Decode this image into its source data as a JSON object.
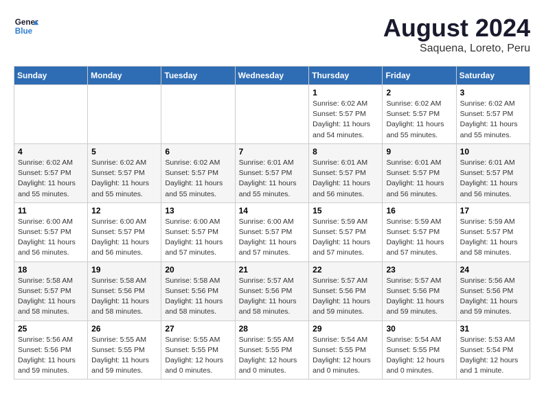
{
  "header": {
    "logo_line1": "General",
    "logo_line2": "Blue",
    "main_title": "August 2024",
    "subtitle": "Saquena, Loreto, Peru"
  },
  "weekdays": [
    "Sunday",
    "Monday",
    "Tuesday",
    "Wednesday",
    "Thursday",
    "Friday",
    "Saturday"
  ],
  "weeks": [
    [
      {
        "day": "",
        "info": ""
      },
      {
        "day": "",
        "info": ""
      },
      {
        "day": "",
        "info": ""
      },
      {
        "day": "",
        "info": ""
      },
      {
        "day": "1",
        "info": "Sunrise: 6:02 AM\nSunset: 5:57 PM\nDaylight: 11 hours and 54 minutes."
      },
      {
        "day": "2",
        "info": "Sunrise: 6:02 AM\nSunset: 5:57 PM\nDaylight: 11 hours and 55 minutes."
      },
      {
        "day": "3",
        "info": "Sunrise: 6:02 AM\nSunset: 5:57 PM\nDaylight: 11 hours and 55 minutes."
      }
    ],
    [
      {
        "day": "4",
        "info": "Sunrise: 6:02 AM\nSunset: 5:57 PM\nDaylight: 11 hours and 55 minutes."
      },
      {
        "day": "5",
        "info": "Sunrise: 6:02 AM\nSunset: 5:57 PM\nDaylight: 11 hours and 55 minutes."
      },
      {
        "day": "6",
        "info": "Sunrise: 6:02 AM\nSunset: 5:57 PM\nDaylight: 11 hours and 55 minutes."
      },
      {
        "day": "7",
        "info": "Sunrise: 6:01 AM\nSunset: 5:57 PM\nDaylight: 11 hours and 55 minutes."
      },
      {
        "day": "8",
        "info": "Sunrise: 6:01 AM\nSunset: 5:57 PM\nDaylight: 11 hours and 56 minutes."
      },
      {
        "day": "9",
        "info": "Sunrise: 6:01 AM\nSunset: 5:57 PM\nDaylight: 11 hours and 56 minutes."
      },
      {
        "day": "10",
        "info": "Sunrise: 6:01 AM\nSunset: 5:57 PM\nDaylight: 11 hours and 56 minutes."
      }
    ],
    [
      {
        "day": "11",
        "info": "Sunrise: 6:00 AM\nSunset: 5:57 PM\nDaylight: 11 hours and 56 minutes."
      },
      {
        "day": "12",
        "info": "Sunrise: 6:00 AM\nSunset: 5:57 PM\nDaylight: 11 hours and 56 minutes."
      },
      {
        "day": "13",
        "info": "Sunrise: 6:00 AM\nSunset: 5:57 PM\nDaylight: 11 hours and 57 minutes."
      },
      {
        "day": "14",
        "info": "Sunrise: 6:00 AM\nSunset: 5:57 PM\nDaylight: 11 hours and 57 minutes."
      },
      {
        "day": "15",
        "info": "Sunrise: 5:59 AM\nSunset: 5:57 PM\nDaylight: 11 hours and 57 minutes."
      },
      {
        "day": "16",
        "info": "Sunrise: 5:59 AM\nSunset: 5:57 PM\nDaylight: 11 hours and 57 minutes."
      },
      {
        "day": "17",
        "info": "Sunrise: 5:59 AM\nSunset: 5:57 PM\nDaylight: 11 hours and 58 minutes."
      }
    ],
    [
      {
        "day": "18",
        "info": "Sunrise: 5:58 AM\nSunset: 5:57 PM\nDaylight: 11 hours and 58 minutes."
      },
      {
        "day": "19",
        "info": "Sunrise: 5:58 AM\nSunset: 5:56 PM\nDaylight: 11 hours and 58 minutes."
      },
      {
        "day": "20",
        "info": "Sunrise: 5:58 AM\nSunset: 5:56 PM\nDaylight: 11 hours and 58 minutes."
      },
      {
        "day": "21",
        "info": "Sunrise: 5:57 AM\nSunset: 5:56 PM\nDaylight: 11 hours and 58 minutes."
      },
      {
        "day": "22",
        "info": "Sunrise: 5:57 AM\nSunset: 5:56 PM\nDaylight: 11 hours and 59 minutes."
      },
      {
        "day": "23",
        "info": "Sunrise: 5:57 AM\nSunset: 5:56 PM\nDaylight: 11 hours and 59 minutes."
      },
      {
        "day": "24",
        "info": "Sunrise: 5:56 AM\nSunset: 5:56 PM\nDaylight: 11 hours and 59 minutes."
      }
    ],
    [
      {
        "day": "25",
        "info": "Sunrise: 5:56 AM\nSunset: 5:56 PM\nDaylight: 11 hours and 59 minutes."
      },
      {
        "day": "26",
        "info": "Sunrise: 5:55 AM\nSunset: 5:55 PM\nDaylight: 11 hours and 59 minutes."
      },
      {
        "day": "27",
        "info": "Sunrise: 5:55 AM\nSunset: 5:55 PM\nDaylight: 12 hours and 0 minutes."
      },
      {
        "day": "28",
        "info": "Sunrise: 5:55 AM\nSunset: 5:55 PM\nDaylight: 12 hours and 0 minutes."
      },
      {
        "day": "29",
        "info": "Sunrise: 5:54 AM\nSunset: 5:55 PM\nDaylight: 12 hours and 0 minutes."
      },
      {
        "day": "30",
        "info": "Sunrise: 5:54 AM\nSunset: 5:55 PM\nDaylight: 12 hours and 0 minutes."
      },
      {
        "day": "31",
        "info": "Sunrise: 5:53 AM\nSunset: 5:54 PM\nDaylight: 12 hours and 1 minute."
      }
    ]
  ]
}
